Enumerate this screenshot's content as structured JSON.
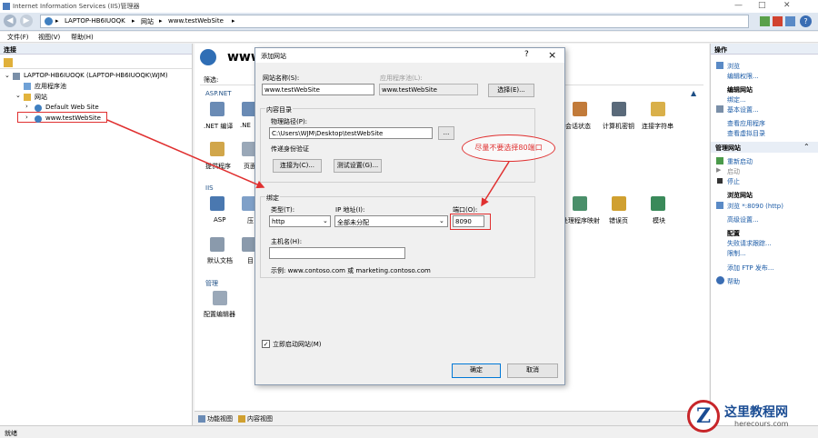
{
  "window": {
    "title": "Internet Information Services (IIS)管理器"
  },
  "address": {
    "crumbs": [
      "LAPTOP-HB6IUOQK",
      "网站",
      "www.testWebSite"
    ]
  },
  "menu": {
    "items": [
      "文件(F)",
      "视图(V)",
      "帮助(H)"
    ]
  },
  "left": {
    "header": "连接",
    "tree": [
      {
        "label": "LAPTOP-HB6IUOQK (LAPTOP-HB6IUOQK\\WJM)"
      },
      {
        "label": "应用程序池"
      },
      {
        "label": "网站"
      },
      {
        "label": "Default Web Site"
      },
      {
        "label": "www.testWebSite"
      }
    ]
  },
  "main": {
    "title": "www.",
    "filter_label": "筛选:",
    "sections": {
      "aspnet": "ASP.NET",
      "iis": "IIS",
      "manage": "管理"
    },
    "icons_row1": [
      ".NET 编译",
      ".NE"
    ],
    "icons_row1_right": [
      "会话状态",
      "计算机密钥",
      "连接字符串"
    ],
    "icons_row2": [
      "提供程序",
      "页面"
    ],
    "icons_iis1": [
      "ASP",
      "压"
    ],
    "icons_iis1_right": [
      "处理程序映射",
      "错误页",
      "模块"
    ],
    "icons_iis2": [
      "默认文档",
      "目"
    ],
    "icons_manage": [
      "配置编辑器"
    ]
  },
  "tabs": {
    "feature": "功能视图",
    "content": "内容视图"
  },
  "right": {
    "header": "操作",
    "items1": [
      "浏览",
      "编辑权限..."
    ],
    "edit_site": "编辑网站",
    "items2": [
      "绑定...",
      "基本设置..."
    ],
    "items3": [
      "查看应用程序",
      "查看虚拟目录"
    ],
    "manage_site": "管理网站",
    "items4": [
      "重新启动",
      "启动",
      "停止"
    ],
    "browse_site": "浏览网站",
    "items5": [
      "浏览 *:8090 (http)",
      "高级设置..."
    ],
    "config": "配置",
    "items6": [
      "失败请求跟踪...",
      "限制...",
      "添加 FTP 发布..."
    ],
    "help": "帮助"
  },
  "status": {
    "text": "就绪"
  },
  "dialog": {
    "title": "添加网站",
    "help": "?",
    "close": "×",
    "site_name_label": "网站名称(S):",
    "site_name_value": "www.testWebSite",
    "app_pool_label": "应用程序池(L):",
    "app_pool_value": "www.testWebSite",
    "select_button": "选择(E)...",
    "content_dir_label": "内容目录",
    "physical_path_label": "物理路径(P):",
    "physical_path_value": "C:\\Users\\WJM\\Desktop\\testWebSite",
    "browse_button": "...",
    "passthrough_label": "传递身份验证",
    "connect_as_button": "连接为(C)...",
    "test_settings_button": "测试设置(G)...",
    "binding_label": "绑定",
    "type_label": "类型(T):",
    "type_value": "http",
    "ip_label": "IP 地址(I):",
    "ip_value": "全部未分配",
    "port_label": "端口(O):",
    "port_value": "8090",
    "hostname_label": "主机名(H):",
    "hostname_value": "",
    "example_text": "示例: www.contoso.com 或 marketing.contoso.com",
    "start_immediately_label": "立即启动网站(M)",
    "ok_button": "确定",
    "cancel_button": "取消"
  },
  "annotation": {
    "callout_text": "尽量不要选择80端口"
  },
  "watermark": {
    "logo_letter": "Z",
    "text": "这里教程网",
    "sub": "herecours.com"
  }
}
